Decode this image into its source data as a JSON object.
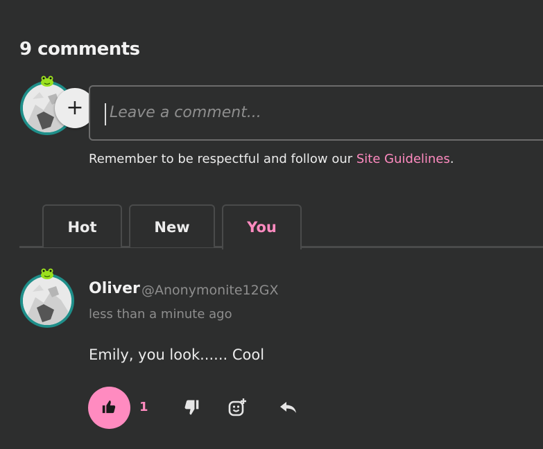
{
  "comments_header": {
    "title": "9 comments"
  },
  "composer": {
    "placeholder": "Leave a comment...",
    "guidelines_prefix": "Remember to be respectful and follow our ",
    "guidelines_link": "Site Guidelines",
    "guidelines_suffix": "."
  },
  "tabs": [
    {
      "label": "Hot",
      "active": false
    },
    {
      "label": "New",
      "active": false
    },
    {
      "label": "You",
      "active": true
    }
  ],
  "comment": {
    "name": "Oliver",
    "handle": "@Anonymonite12GX",
    "time": "less than a minute ago",
    "body": "Emily, you look...... Cool",
    "likes": "1"
  },
  "colors": {
    "accent": "#ff8bc0",
    "background": "#2d2e2e",
    "avatar_ring": "#1f8f8a"
  },
  "icons": [
    "plus-icon",
    "thumbs-up-icon",
    "thumbs-down-icon",
    "add-reaction-icon",
    "reply-icon",
    "frog-badge-icon"
  ]
}
